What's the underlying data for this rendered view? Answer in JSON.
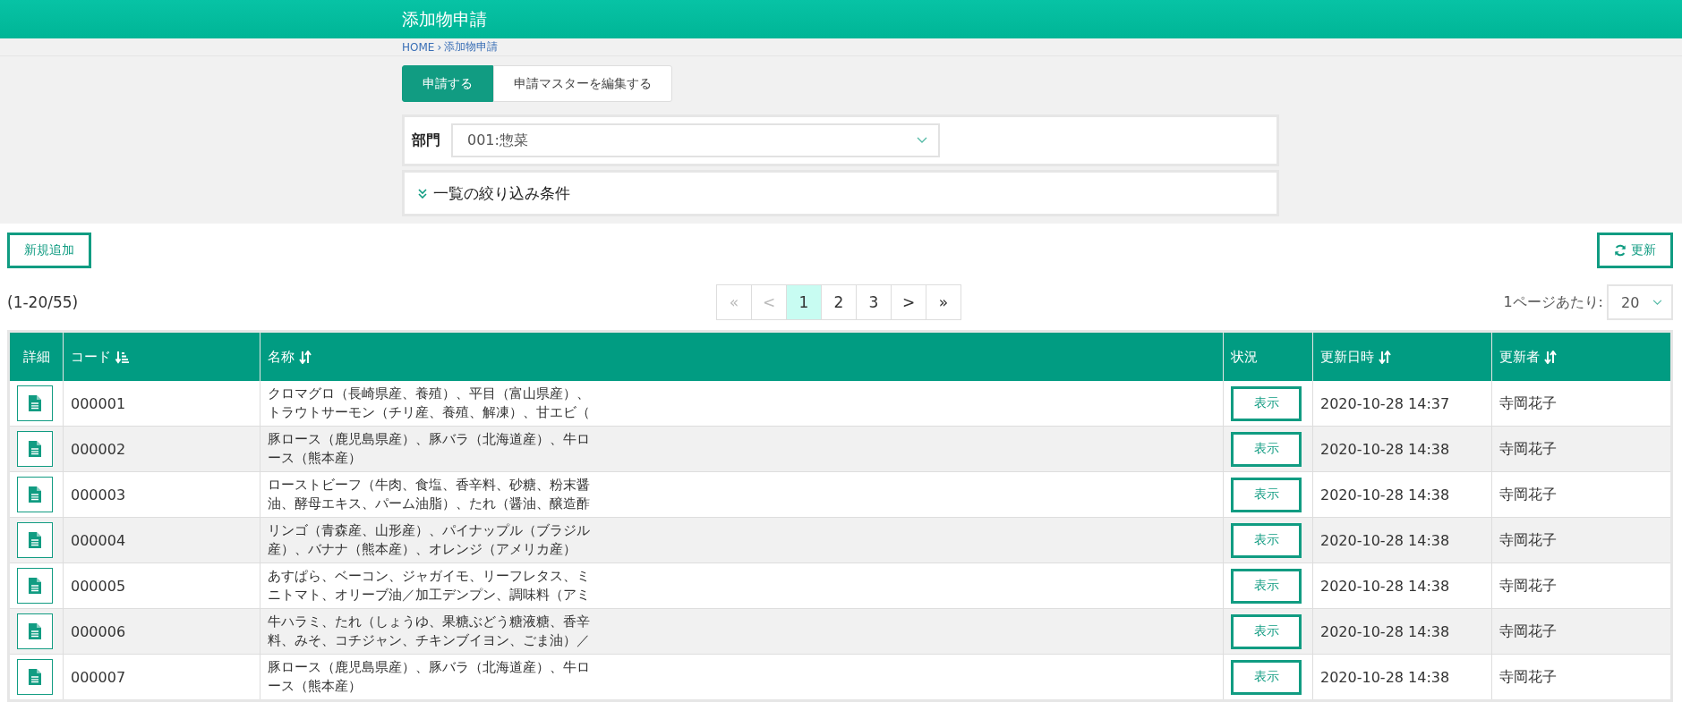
{
  "header": {
    "title": "添加物申請"
  },
  "breadcrumb": [
    {
      "label": "HOME"
    },
    {
      "label": "添加物申請"
    }
  ],
  "breadcrumb_separator": "›",
  "tabs": [
    {
      "label": "申請する",
      "selected": true
    },
    {
      "label": "申請マスターを編集する",
      "selected": false
    }
  ],
  "department": {
    "label": "部門",
    "value": "001:惣菜"
  },
  "filter": {
    "label": "一覧の絞り込み条件",
    "expanded": false
  },
  "add_button": "新規追加",
  "refresh_button": "更新",
  "count": "(1-20/55)",
  "pagination": [
    {
      "label": "«",
      "selected": false,
      "disabled": true
    },
    {
      "label": "<",
      "selected": false,
      "disabled": true
    },
    {
      "label": "1",
      "selected": true,
      "disabled": false
    },
    {
      "label": "2",
      "selected": false,
      "disabled": false
    },
    {
      "label": "3",
      "selected": false,
      "disabled": false
    },
    {
      "label": ">",
      "selected": false,
      "disabled": false
    },
    {
      "label": "»",
      "selected": false,
      "disabled": false
    }
  ],
  "per_page": {
    "label": "1ページあたり:",
    "value": "20"
  },
  "table": {
    "columns": [
      {
        "label": "詳細",
        "kind": "plain"
      },
      {
        "label": "コード",
        "kind": "sorted"
      },
      {
        "label": "名称",
        "kind": "sortable"
      },
      {
        "label": "状況",
        "kind": "plain"
      },
      {
        "label": "更新日時",
        "kind": "sortable"
      },
      {
        "label": "更新者",
        "kind": "sortable"
      }
    ],
    "rows": [
      {
        "code": "000001",
        "name_lines": [
          "クロマグロ（長崎県産、養殖）、平目（富山県産）、",
          "トラウトサーモン（チリ産、養殖、解凍）、甘エビ（"
        ],
        "status": "表示",
        "updated": "2020-10-28 14:37",
        "updater": "寺岡花子"
      },
      {
        "code": "000002",
        "name_lines": [
          "豚ロース（鹿児島県産）、豚バラ（北海道産）、牛ロ",
          "ース（熊本産）"
        ],
        "status": "表示",
        "updated": "2020-10-28 14:38",
        "updater": "寺岡花子"
      },
      {
        "code": "000003",
        "name_lines": [
          "ローストビーフ（牛肉、食塩、香辛料、砂糖、粉末醤",
          "油、酵母エキス、パーム油脂）、たれ（醤油、醸造酢"
        ],
        "status": "表示",
        "updated": "2020-10-28 14:38",
        "updater": "寺岡花子"
      },
      {
        "code": "000004",
        "name_lines": [
          "リンゴ（青森産、山形産）、パイナップル（ブラジル",
          "産）、バナナ（熊本産）、オレンジ（アメリカ産）"
        ],
        "status": "表示",
        "updated": "2020-10-28 14:38",
        "updater": "寺岡花子"
      },
      {
        "code": "000005",
        "name_lines": [
          "あすぱら、ベーコン、ジャガイモ、リーフレタス、ミ",
          "ニトマト、オリーブ油／加工デンプン、調味料（アミ"
        ],
        "status": "表示",
        "updated": "2020-10-28 14:38",
        "updater": "寺岡花子"
      },
      {
        "code": "000006",
        "name_lines": [
          "牛ハラミ、たれ（しょうゆ、果糖ぶどう糖液糖、香辛",
          "料、みそ、コチジャン、チキンブイヨン、ごま油）／"
        ],
        "status": "表示",
        "updated": "2020-10-28 14:38",
        "updater": "寺岡花子"
      },
      {
        "code": "000007",
        "name_lines": [
          "豚ロース（鹿児島県産）、豚バラ（北海道産）、牛ロ",
          "ース（熊本産）"
        ],
        "status": "表示",
        "updated": "2020-10-28 14:38",
        "updater": "寺岡花子"
      }
    ]
  }
}
